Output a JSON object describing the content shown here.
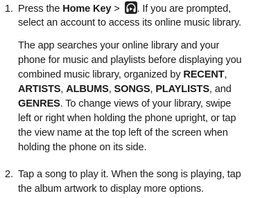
{
  "step1": {
    "number": "1.",
    "line1_pre": "Press the ",
    "line1_bold": "Home Key",
    "line1_mid": " > ",
    "icon": "play-music-headphones-icon",
    "line1_post": ". If you are prompted,",
    "line2": "select an account to access its online music library."
  },
  "para": {
    "line1": "The app searches your online library and your",
    "line2": "phone for music and playlists before displaying you",
    "line3_pre": "combined music library, organized by ",
    "line3_bold": "RECENT",
    "line3_post": ",",
    "line4_b1": "ARTISTS",
    "line4_s1": ", ",
    "line4_b2": "ALBUMS",
    "line4_s2": ", ",
    "line4_b3": "SONGS",
    "line4_s3": ", ",
    "line4_b4": "PLAYLISTS",
    "line4_s4": ", and",
    "line5_bold": "GENRES",
    "line5_post": ". To change views of your library, swipe",
    "line6": "left or right when holding the phone upright, or tap",
    "line7": "the view name at the top left of the screen when",
    "line8": "holding the phone on its side."
  },
  "step2": {
    "number": "2.",
    "line1": "Tap a song to play it. When the song is playing, tap",
    "line2": "the album artwork to display more options."
  }
}
